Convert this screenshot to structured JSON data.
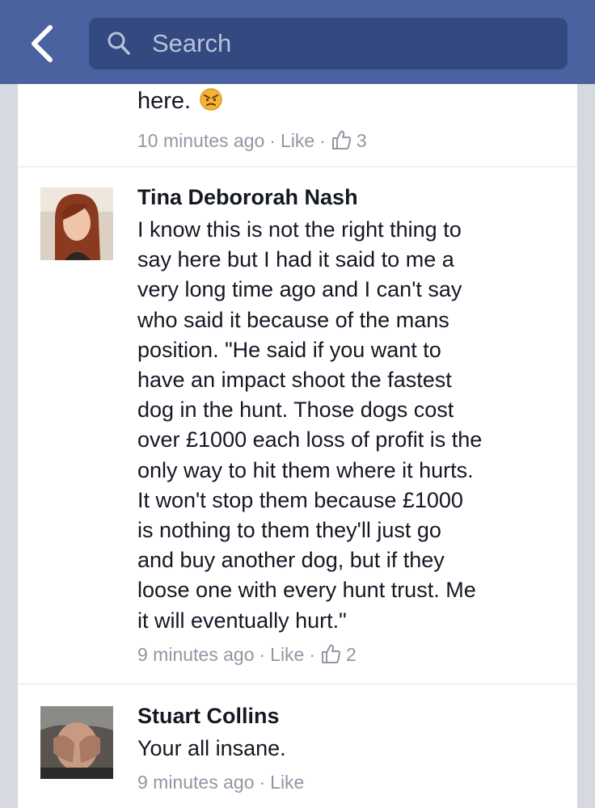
{
  "header": {
    "search_placeholder": "Search"
  },
  "icons": {
    "back": "chevron-left-icon",
    "search": "search-icon",
    "like": "thumbs-up-icon",
    "angry": "angry-face-emoji-icon"
  },
  "colors": {
    "header_bg": "#4a63a0",
    "search_bg": "#34497f",
    "page_bg": "#d6d9df",
    "text": "#141823",
    "meta": "#9197a3"
  },
  "comments": [
    {
      "text_tail": "here.",
      "time": "10 minutes ago",
      "like_label": "Like",
      "like_count": "3"
    },
    {
      "author": "Tina Debororah Nash",
      "lines": [
        "I know this is not the right thing to",
        "say here but I had it said to me a",
        "very long time ago and I can't say",
        "who said it because of the mans",
        "position. \"He said if you want to",
        "have an impact shoot the fastest",
        "dog in the hunt. Those dogs cost",
        "over £1000 each loss of profit is the",
        "only way to hit them where it hurts.",
        "It won't stop them because £1000",
        "is nothing to them they'll just go",
        "and buy another dog, but if they",
        "loose one with every hunt trust. Me",
        "it will eventually hurt.\""
      ],
      "time": "9 minutes ago",
      "like_label": "Like",
      "like_count": "2"
    },
    {
      "author": "Stuart Collins",
      "text": "Your all insane.",
      "time": "9 minutes ago",
      "like_label": "Like"
    }
  ]
}
